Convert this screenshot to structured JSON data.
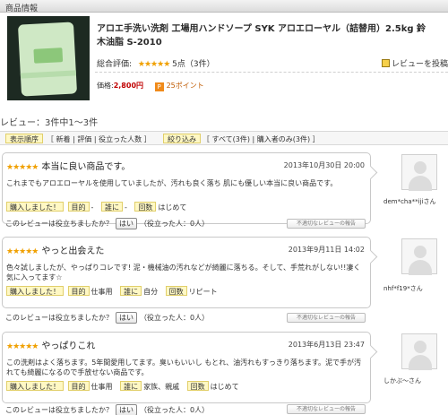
{
  "product": {
    "header": "商品情報",
    "title_line1": "アロエ手洗い洗剤 工場用ハンドソープ SYK アロエローヤル（詰替用）2.5kg 鈴",
    "title_line2": "木油脂 S-2010",
    "rating_label": "総合評価:",
    "rating_stars": "★★★★★",
    "rating_value": "5点（3件）",
    "post_review": "レビューを投稿す",
    "price_label": "価格:",
    "price": "2,800円",
    "points": "25ポイント",
    "point_icon": "P"
  },
  "review_count": "レビュー：3件中1～3件",
  "sort_bar": {
    "order_label": "表示順序",
    "order_options": "［ 新着 | 評価 | 役立った人数 ］",
    "filter_label": "絞り込み",
    "filter_options": "［ すべて(3件) | 購入者のみ(3件) ］"
  },
  "labels": {
    "purchased": "購入しました！",
    "purpose": "目的",
    "whom": "誰に",
    "count": "回数",
    "helpful_question": "このレビューは役立ちましたか？",
    "yes": "はい",
    "report": "不適切なレビューの報告"
  },
  "reviews": [
    {
      "stars": "★★★★★",
      "title": "本当に良い商品です。",
      "date": "2013年10月30日 20:00",
      "body": "これまでもアロエローヤルを使用していましたが、汚れも良く落ち 肌にも優しい本当に良い商品です。",
      "purpose": "-",
      "whom": "-",
      "count": "はじめて",
      "helpful": "（役立った人：0人）",
      "reviewer": "dem*cha**ijiさん"
    },
    {
      "stars": "★★★★★",
      "title": "やっと出会えた",
      "date": "2013年9月11日 14:02",
      "body": "色々試しましたが、やっぱりコレです! 泥・機械油の汚れなどが綺麗に落ちる。そして、手荒れがしない!!凄く気に入ってます☆",
      "purpose": "仕事用",
      "whom": "自分",
      "count": "リピート",
      "helpful": "（役立った人：0人）",
      "reviewer": "nhf*f19*さん"
    },
    {
      "stars": "★★★★★",
      "title": "やっぱりこれ",
      "date": "2013年6月13日 23:47",
      "body": "この洗剤はよく落ちます。5年間愛用してます。臭いもいいし もとれ、油汚れもすっきり落ちます。泥で手が汚れても綺麗になるので手放せない商品です。",
      "purpose": "仕事用",
      "whom": "家族、親戚",
      "count": "はじめて",
      "helpful": "（役立った人：0人）",
      "reviewer": "しかぶ～さん"
    }
  ],
  "colors": {
    "star": "#f0a000",
    "price": "#c00000",
    "tag_bg": "#fff8c4"
  }
}
